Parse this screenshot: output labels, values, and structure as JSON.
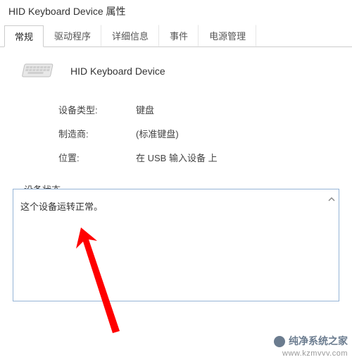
{
  "window": {
    "title": "HID Keyboard Device 属性"
  },
  "tabs": {
    "items": [
      {
        "label": "常规",
        "active": true
      },
      {
        "label": "驱动程序",
        "active": false
      },
      {
        "label": "详细信息",
        "active": false
      },
      {
        "label": "事件",
        "active": false
      },
      {
        "label": "电源管理",
        "active": false
      }
    ]
  },
  "device": {
    "name": "HID Keyboard Device",
    "type_label": "设备类型:",
    "type_value": "键盘",
    "manufacturer_label": "制造商:",
    "manufacturer_value": "(标准键盘)",
    "location_label": "位置:",
    "location_value": "在 USB 输入设备 上"
  },
  "status": {
    "label": "设备状态",
    "text": "这个设备运转正常。"
  },
  "annotation": {
    "color": "#ff0000"
  },
  "watermark": {
    "line1": "纯净系统之家",
    "line2": "www.kzmvvv.com"
  }
}
